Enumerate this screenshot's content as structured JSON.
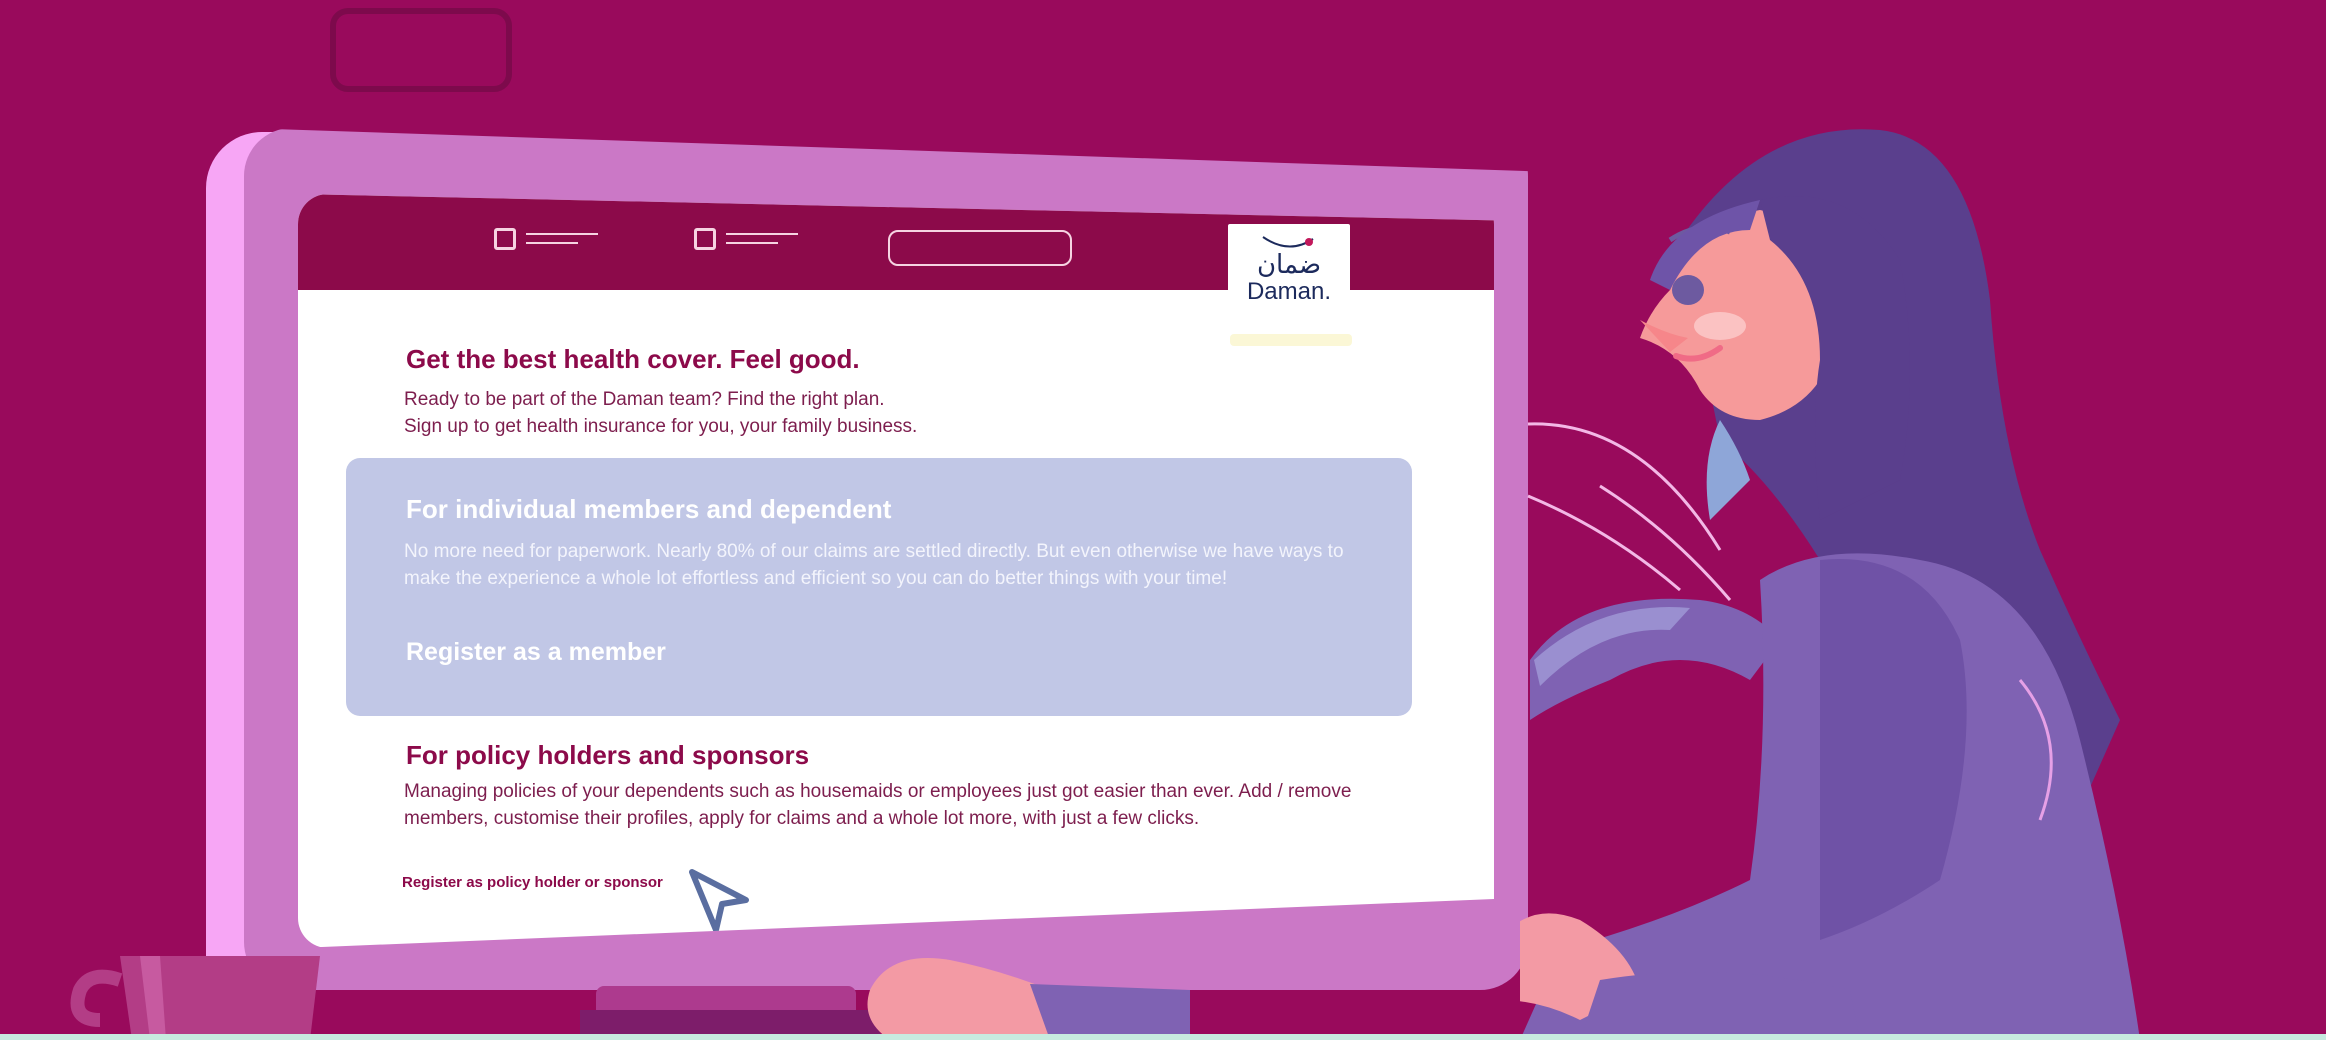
{
  "brand": {
    "logo_arabic": "ضمان",
    "logo_latin": "Daman."
  },
  "hero": {
    "title": "Get the best health cover. Feel good.",
    "line1": "Ready to be part of the Daman team? Find the right plan.",
    "line2": "Sign up to get health insurance for you, your family business."
  },
  "individual": {
    "title": "For individual members and dependent",
    "text": "No more need for paperwork. Nearly 80% of our claims are settled directly. But even otherwise we have ways to make the experience a whole lot effortless and efficient so you can do better things with your time!",
    "link": "Register as a member"
  },
  "policy": {
    "title": "For policy holders and sponsors",
    "text": "Managing policies of your dependents such as housemaids or employees just got easier than ever. Add / remove members, customise their profiles, apply for claims and a whole lot more, with just a few clicks.",
    "link": "Register as policy holder or sponsor"
  },
  "colors": {
    "background": "#990a5c",
    "navbar": "#8c0a4a",
    "card": "#c1c7e6",
    "monitor": "#cb78c6"
  },
  "icons": [
    "cursor-arrow-icon",
    "daman-logo-icon"
  ]
}
